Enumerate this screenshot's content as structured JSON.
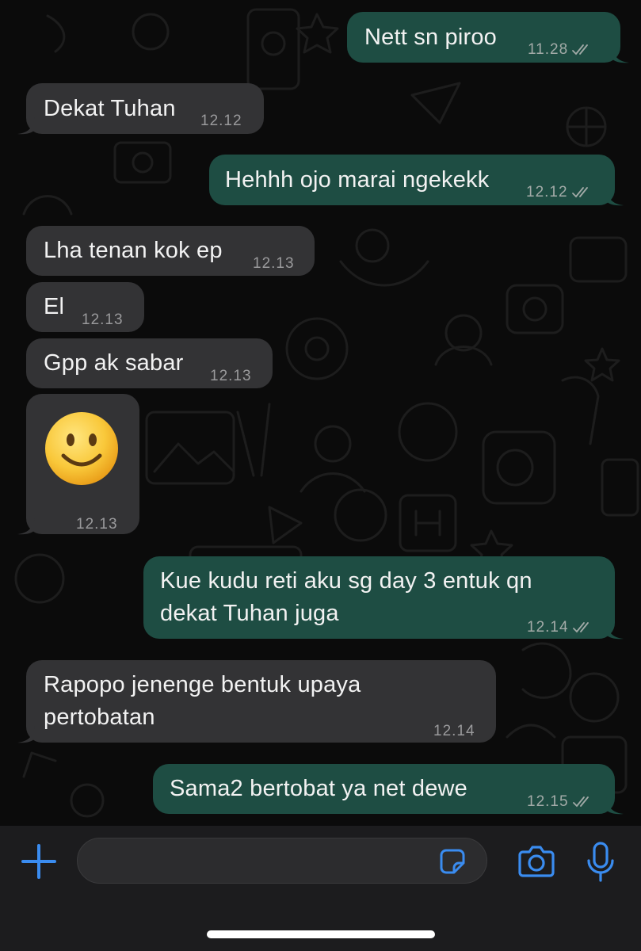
{
  "chat": {
    "messages": [
      {
        "direction": "outgoing",
        "text": "Nett sn piroo",
        "time": "11.28",
        "status": "read"
      },
      {
        "direction": "incoming",
        "text": "Dekat Tuhan",
        "time": "12.12"
      },
      {
        "direction": "outgoing",
        "text": "Hehhh ojo marai ngekekk",
        "time": "12.12",
        "status": "read"
      },
      {
        "direction": "incoming",
        "text": "Lha tenan kok ep",
        "time": "12.13"
      },
      {
        "direction": "incoming",
        "text": "El",
        "time": "12.13"
      },
      {
        "direction": "incoming",
        "text": "Gpp ak sabar",
        "time": "12.13"
      },
      {
        "direction": "incoming",
        "emoji": "slightly-smiling-face",
        "time": "12.13"
      },
      {
        "direction": "outgoing",
        "lines": [
          "Kue kudu reti aku sg day 3 entuk qn",
          "dekat Tuhan juga"
        ],
        "time": "12.14",
        "status": "read"
      },
      {
        "direction": "incoming",
        "lines": [
          "Rapopo jenenge bentuk upaya",
          "pertobatan"
        ],
        "time": "12.14"
      },
      {
        "direction": "outgoing",
        "text": "Sama2 bertobat ya net dewe",
        "time": "12.15",
        "status": "read"
      }
    ]
  },
  "input_bar": {
    "message_value": "",
    "icons": [
      "plus-icon",
      "sticker-icon",
      "camera-icon",
      "microphone-icon"
    ]
  },
  "colors": {
    "chat_background": "#0b0b0b",
    "incoming_bubble": "#333335",
    "outgoing_bubble": "#1e4d43",
    "accent": "#3a8cf0",
    "input_bar": "#1c1c1e"
  }
}
